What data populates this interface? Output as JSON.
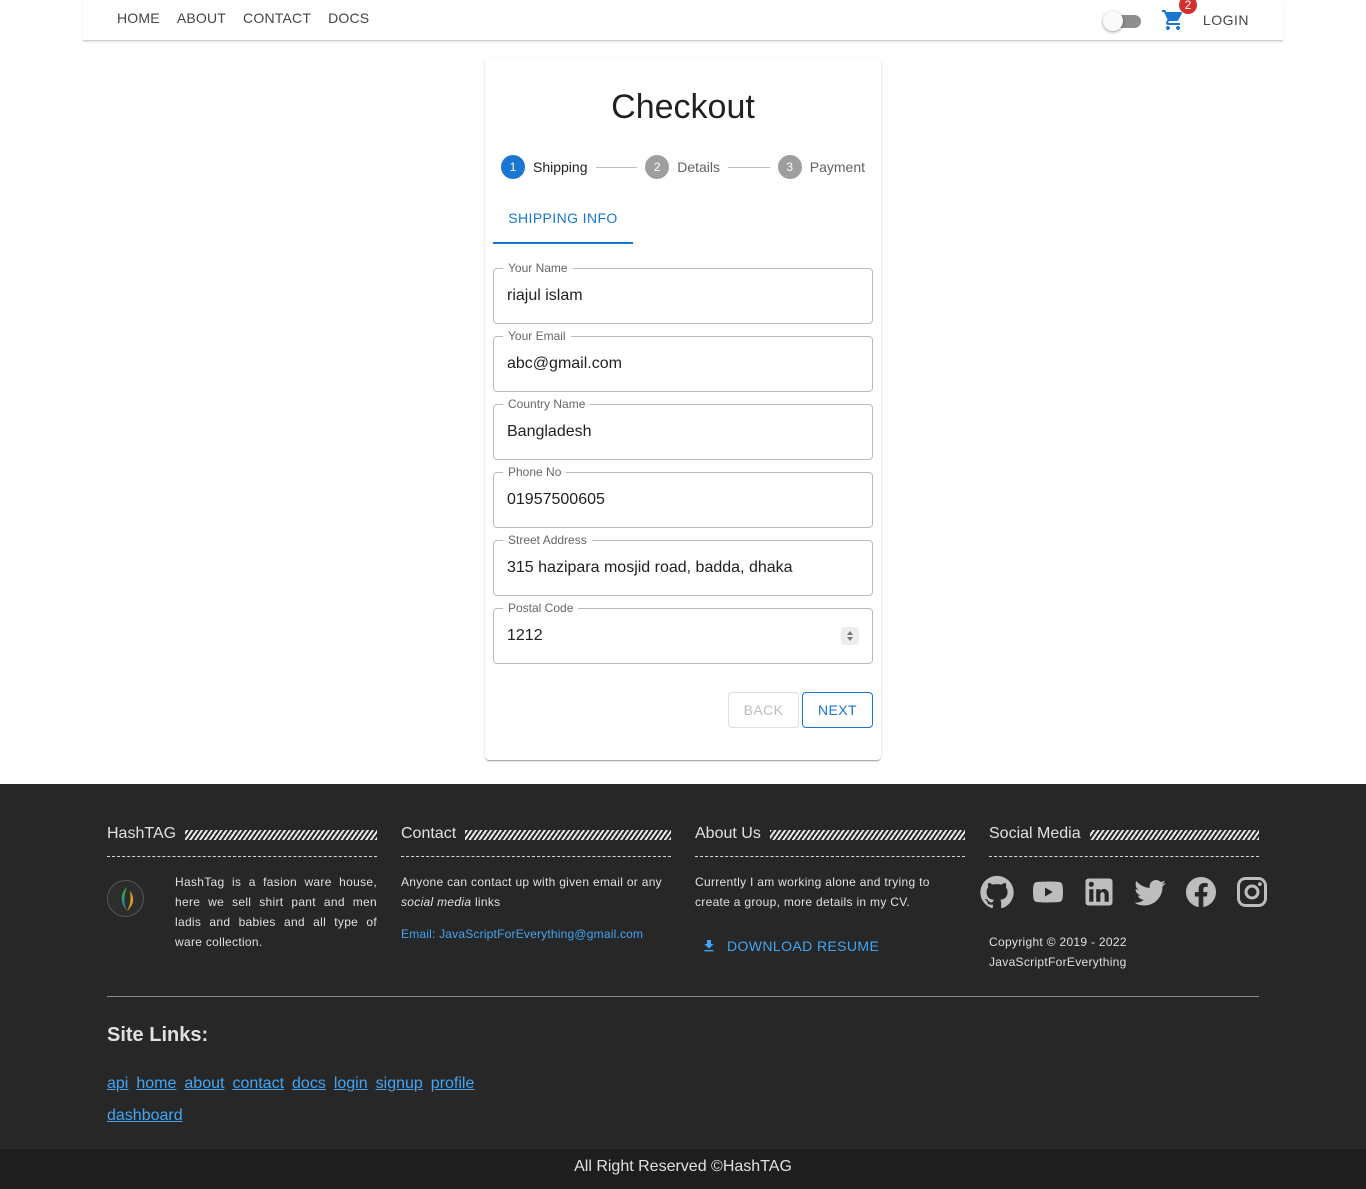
{
  "navbar": {
    "links": [
      "HOME",
      "ABOUT",
      "CONTACT",
      "DOCS"
    ],
    "cart_count": "2",
    "login_label": "LOGIN",
    "theme_toggle_on": false
  },
  "checkout": {
    "title": "Checkout",
    "steps": [
      {
        "number": "1",
        "label": "Shipping",
        "active": true
      },
      {
        "number": "2",
        "label": "Details",
        "active": false
      },
      {
        "number": "3",
        "label": "Payment",
        "active": false
      }
    ],
    "tab_label": "SHIPPING INFO",
    "fields": [
      {
        "label": "Your Name",
        "value": "riajul islam"
      },
      {
        "label": "Your Email",
        "value": "abc@gmail.com"
      },
      {
        "label": "Country Name",
        "value": "Bangladesh"
      },
      {
        "label": "Phone No",
        "value": "01957500605"
      },
      {
        "label": "Street Address",
        "value": "315 hazipara mosjid road, badda, dhaka"
      },
      {
        "label": "Postal Code",
        "value": "1212"
      }
    ],
    "back_label": "BACK",
    "next_label": "NEXT"
  },
  "footer": {
    "hashtag": {
      "title": "HashTAG",
      "description": "HashTag is a fasion ware house, here we sell shirt pant and men ladis and babies and all type of ware collection."
    },
    "contact": {
      "title": "Contact",
      "description_before": "Anyone can contact up with given email or any ",
      "description_em": "social media",
      "description_after": " links",
      "email": "Email: JavaScriptForEverything@gmail.com"
    },
    "about": {
      "title": "About Us",
      "description": "Currently I am working alone and trying to create a group, more details in my CV.",
      "download_label": "DOWNLOAD RESUME"
    },
    "social": {
      "title": "Social Media",
      "icons": [
        "github-icon",
        "youtube-icon",
        "linkedin-icon",
        "twitter-icon",
        "facebook-icon",
        "instagram-icon"
      ],
      "copyright_line1": "Copyright © 2019 - 2022",
      "copyright_line2": "JavaScriptForEverything"
    },
    "site_links_title": "Site Links:",
    "site_links": [
      "api",
      "home",
      "about",
      "contact",
      "docs",
      "login",
      "signup",
      "profile",
      "dashboard"
    ],
    "bottom_text": "All Right Reserved ©HashTAG"
  },
  "colors": {
    "primary": "#1976d2",
    "badge": "#d32f2f",
    "footer_bg": "#272727",
    "link": "#42a5f5"
  }
}
